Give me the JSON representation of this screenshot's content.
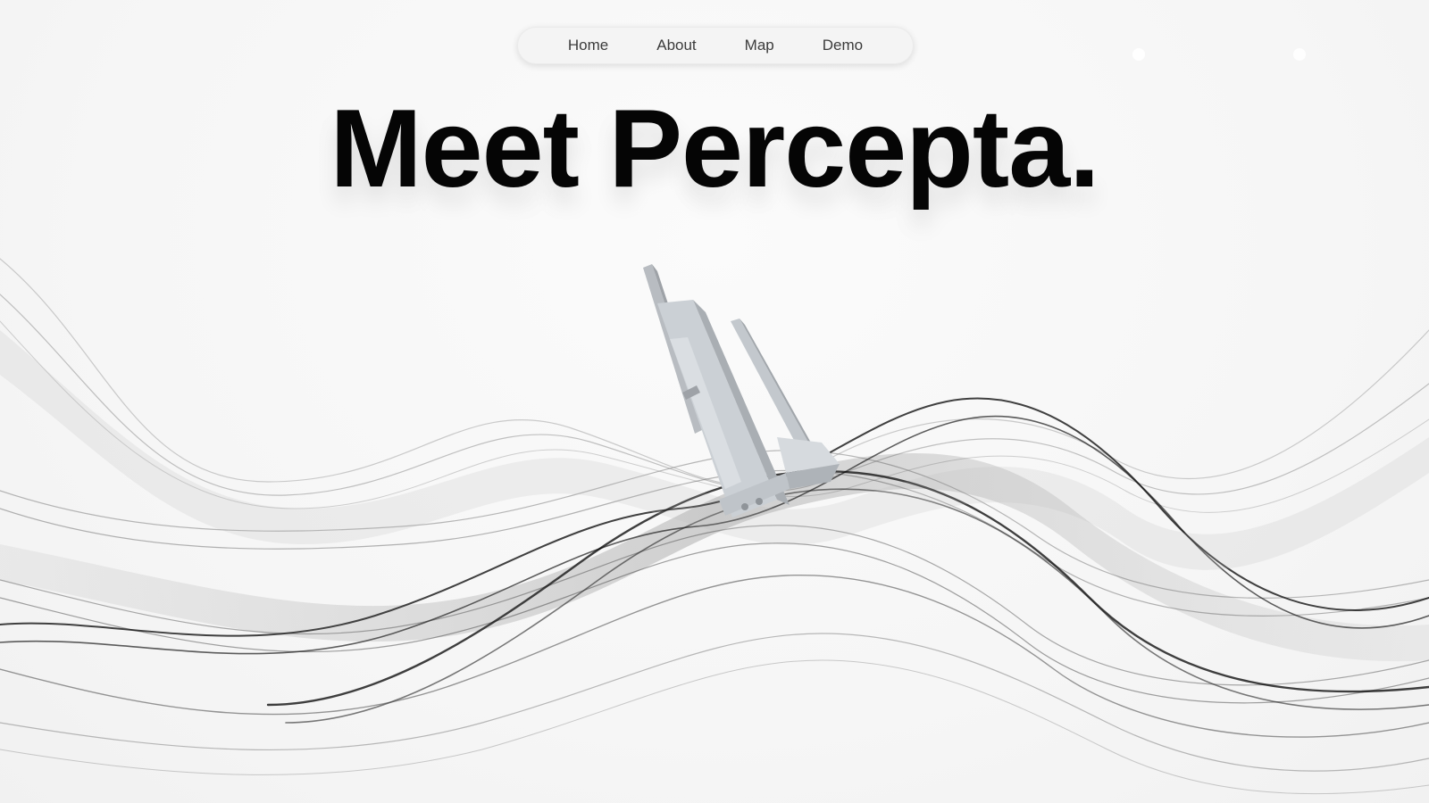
{
  "nav": {
    "items": [
      {
        "label": "Home"
      },
      {
        "label": "About"
      },
      {
        "label": "Map"
      },
      {
        "label": "Demo"
      }
    ]
  },
  "hero": {
    "title": "Meet Percepta."
  },
  "colors": {
    "background": "#f7f7f7",
    "title": "#050505",
    "nav_text": "#3b3b3b",
    "nav_bg": "#f4f4f4",
    "wave_dark": "#111111",
    "wave_light": "#9a9a9a",
    "object": "#c9cdd1"
  },
  "icons": {
    "hero_object": "grey-3d-structure-icon"
  }
}
